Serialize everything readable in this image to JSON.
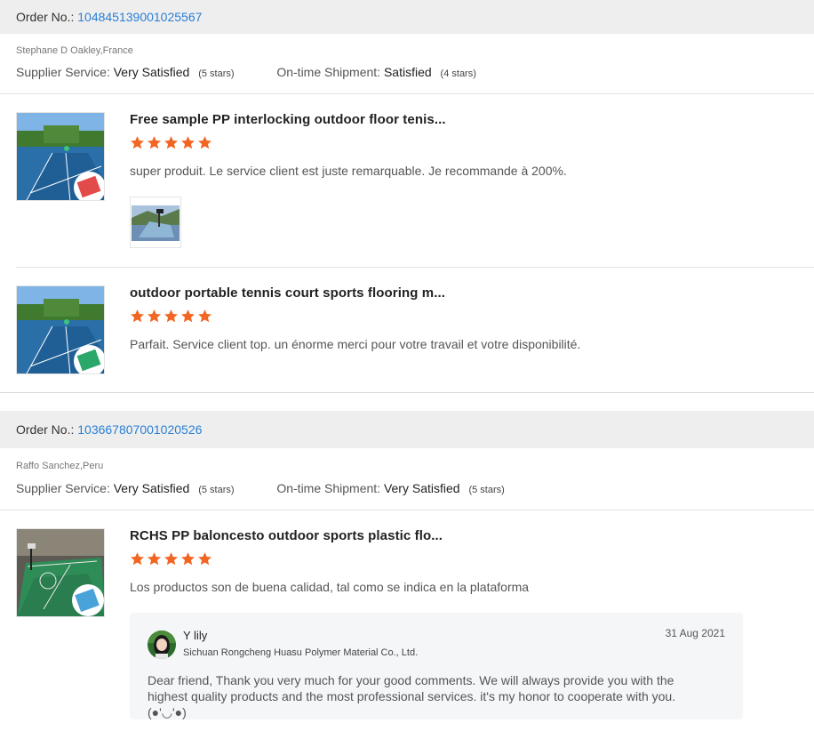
{
  "colors": {
    "link": "#2a7fd4",
    "star": "#f26522",
    "header_bg": "#eeeeee",
    "reply_bg": "#f5f6f8"
  },
  "orders": [
    {
      "label": "Order No.:",
      "number": "104845139001025567",
      "buyer": "Stephane D Oakley,France",
      "supplier_service": {
        "label": "Supplier Service:",
        "value": "Very Satisfied",
        "stars": "(5 stars)"
      },
      "shipment": {
        "label": "On-time Shipment:",
        "value": "Satisfied",
        "stars": "(4 stars)"
      },
      "products": [
        {
          "title": "Free sample PP interlocking outdoor floor tenis...",
          "rating": 5,
          "review": "super produit. Le service client est juste remarquable. Je recommande à 200%."
        },
        {
          "title": "outdoor portable tennis court sports flooring m...",
          "rating": 5,
          "review": "Parfait. Service client top. un énorme merci pour votre travail et votre disponibilité."
        }
      ]
    },
    {
      "label": "Order No.:",
      "number": "103667807001020526",
      "buyer": "Raffo Sanchez,Peru",
      "supplier_service": {
        "label": "Supplier Service:",
        "value": "Very Satisfied",
        "stars": "(5 stars)"
      },
      "shipment": {
        "label": "On-time Shipment:",
        "value": "Very Satisfied",
        "stars": "(5 stars)"
      },
      "products": [
        {
          "title": "RCHS PP baloncesto outdoor sports plastic flo...",
          "rating": 5,
          "review": "Los productos son de buena calidad, tal como se indica en la plataforma"
        }
      ],
      "reply": {
        "name": "Y lily",
        "company": "Sichuan Rongcheng Huasu Polymer Material Co., Ltd.",
        "date": "31 Aug 2021",
        "text": "Dear friend, Thank you very much for your good comments. We will always provide you with the highest quality products and the most professional services. it's my honor to cooperate with you. (●'◡'●)"
      }
    }
  ]
}
